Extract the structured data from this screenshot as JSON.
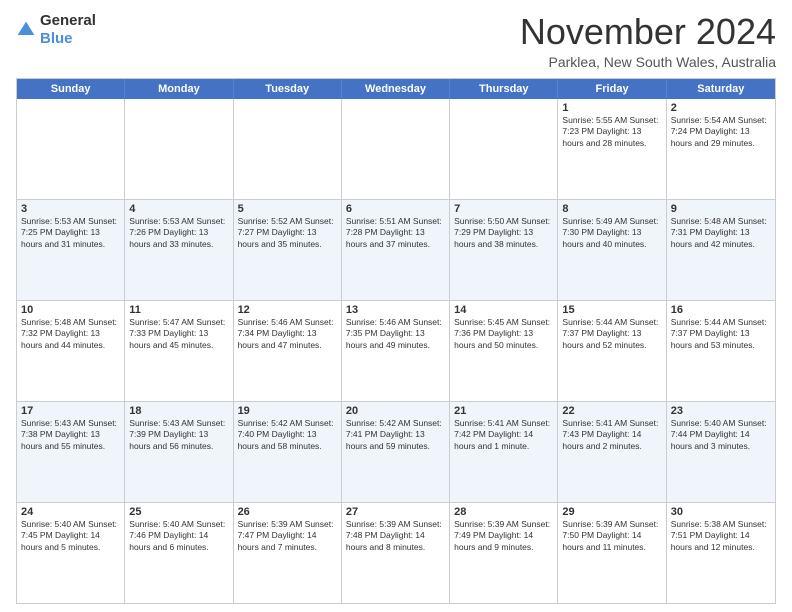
{
  "logo": {
    "text_general": "General",
    "text_blue": "Blue"
  },
  "header": {
    "month": "November 2024",
    "location": "Parklea, New South Wales, Australia"
  },
  "weekdays": [
    "Sunday",
    "Monday",
    "Tuesday",
    "Wednesday",
    "Thursday",
    "Friday",
    "Saturday"
  ],
  "weeks": [
    [
      {
        "day": "",
        "info": ""
      },
      {
        "day": "",
        "info": ""
      },
      {
        "day": "",
        "info": ""
      },
      {
        "day": "",
        "info": ""
      },
      {
        "day": "",
        "info": ""
      },
      {
        "day": "1",
        "info": "Sunrise: 5:55 AM\nSunset: 7:23 PM\nDaylight: 13 hours\nand 28 minutes."
      },
      {
        "day": "2",
        "info": "Sunrise: 5:54 AM\nSunset: 7:24 PM\nDaylight: 13 hours\nand 29 minutes."
      }
    ],
    [
      {
        "day": "3",
        "info": "Sunrise: 5:53 AM\nSunset: 7:25 PM\nDaylight: 13 hours\nand 31 minutes."
      },
      {
        "day": "4",
        "info": "Sunrise: 5:53 AM\nSunset: 7:26 PM\nDaylight: 13 hours\nand 33 minutes."
      },
      {
        "day": "5",
        "info": "Sunrise: 5:52 AM\nSunset: 7:27 PM\nDaylight: 13 hours\nand 35 minutes."
      },
      {
        "day": "6",
        "info": "Sunrise: 5:51 AM\nSunset: 7:28 PM\nDaylight: 13 hours\nand 37 minutes."
      },
      {
        "day": "7",
        "info": "Sunrise: 5:50 AM\nSunset: 7:29 PM\nDaylight: 13 hours\nand 38 minutes."
      },
      {
        "day": "8",
        "info": "Sunrise: 5:49 AM\nSunset: 7:30 PM\nDaylight: 13 hours\nand 40 minutes."
      },
      {
        "day": "9",
        "info": "Sunrise: 5:48 AM\nSunset: 7:31 PM\nDaylight: 13 hours\nand 42 minutes."
      }
    ],
    [
      {
        "day": "10",
        "info": "Sunrise: 5:48 AM\nSunset: 7:32 PM\nDaylight: 13 hours\nand 44 minutes."
      },
      {
        "day": "11",
        "info": "Sunrise: 5:47 AM\nSunset: 7:33 PM\nDaylight: 13 hours\nand 45 minutes."
      },
      {
        "day": "12",
        "info": "Sunrise: 5:46 AM\nSunset: 7:34 PM\nDaylight: 13 hours\nand 47 minutes."
      },
      {
        "day": "13",
        "info": "Sunrise: 5:46 AM\nSunset: 7:35 PM\nDaylight: 13 hours\nand 49 minutes."
      },
      {
        "day": "14",
        "info": "Sunrise: 5:45 AM\nSunset: 7:36 PM\nDaylight: 13 hours\nand 50 minutes."
      },
      {
        "day": "15",
        "info": "Sunrise: 5:44 AM\nSunset: 7:37 PM\nDaylight: 13 hours\nand 52 minutes."
      },
      {
        "day": "16",
        "info": "Sunrise: 5:44 AM\nSunset: 7:37 PM\nDaylight: 13 hours\nand 53 minutes."
      }
    ],
    [
      {
        "day": "17",
        "info": "Sunrise: 5:43 AM\nSunset: 7:38 PM\nDaylight: 13 hours\nand 55 minutes."
      },
      {
        "day": "18",
        "info": "Sunrise: 5:43 AM\nSunset: 7:39 PM\nDaylight: 13 hours\nand 56 minutes."
      },
      {
        "day": "19",
        "info": "Sunrise: 5:42 AM\nSunset: 7:40 PM\nDaylight: 13 hours\nand 58 minutes."
      },
      {
        "day": "20",
        "info": "Sunrise: 5:42 AM\nSunset: 7:41 PM\nDaylight: 13 hours\nand 59 minutes."
      },
      {
        "day": "21",
        "info": "Sunrise: 5:41 AM\nSunset: 7:42 PM\nDaylight: 14 hours\nand 1 minute."
      },
      {
        "day": "22",
        "info": "Sunrise: 5:41 AM\nSunset: 7:43 PM\nDaylight: 14 hours\nand 2 minutes."
      },
      {
        "day": "23",
        "info": "Sunrise: 5:40 AM\nSunset: 7:44 PM\nDaylight: 14 hours\nand 3 minutes."
      }
    ],
    [
      {
        "day": "24",
        "info": "Sunrise: 5:40 AM\nSunset: 7:45 PM\nDaylight: 14 hours\nand 5 minutes."
      },
      {
        "day": "25",
        "info": "Sunrise: 5:40 AM\nSunset: 7:46 PM\nDaylight: 14 hours\nand 6 minutes."
      },
      {
        "day": "26",
        "info": "Sunrise: 5:39 AM\nSunset: 7:47 PM\nDaylight: 14 hours\nand 7 minutes."
      },
      {
        "day": "27",
        "info": "Sunrise: 5:39 AM\nSunset: 7:48 PM\nDaylight: 14 hours\nand 8 minutes."
      },
      {
        "day": "28",
        "info": "Sunrise: 5:39 AM\nSunset: 7:49 PM\nDaylight: 14 hours\nand 9 minutes."
      },
      {
        "day": "29",
        "info": "Sunrise: 5:39 AM\nSunset: 7:50 PM\nDaylight: 14 hours\nand 11 minutes."
      },
      {
        "day": "30",
        "info": "Sunrise: 5:38 AM\nSunset: 7:51 PM\nDaylight: 14 hours\nand 12 minutes."
      }
    ]
  ]
}
